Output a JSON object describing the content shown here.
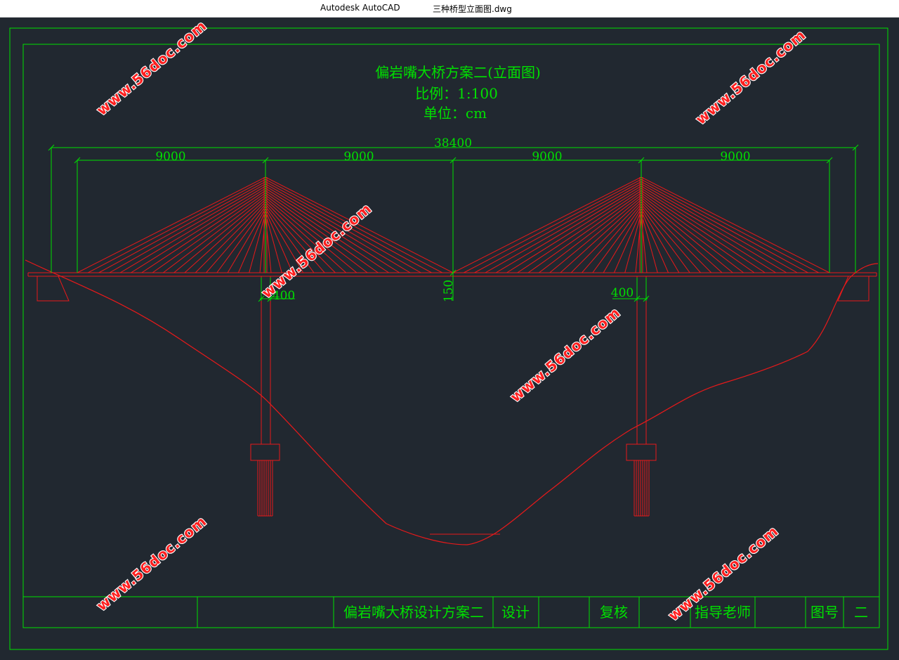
{
  "window": {
    "app_name": "Autodesk AutoCAD",
    "file_name": "三种桥型立面图.dwg"
  },
  "drawing": {
    "title": "偏岩嘴大桥方案二(立面图)",
    "scale_label": "比例：1:100",
    "unit_label": "单位：cm",
    "dim_total": "38400",
    "dim_spans": [
      "9000",
      "9000",
      "9000",
      "9000"
    ],
    "dim_tower_left": "400",
    "dim_tower_right": "400",
    "dim_deck": "150"
  },
  "title_block": {
    "project": "偏岩嘴大桥设计方案二",
    "design": "设计",
    "review": "复核",
    "advisor": "指导老师",
    "drawing_no_label": "图号",
    "drawing_no": "二"
  },
  "watermark": "www.56doc.com",
  "colors": {
    "background": "#212830",
    "border": "#00e000",
    "structure": "#e8191a",
    "text": "#00e000",
    "watermark": "#ff1f1f"
  }
}
